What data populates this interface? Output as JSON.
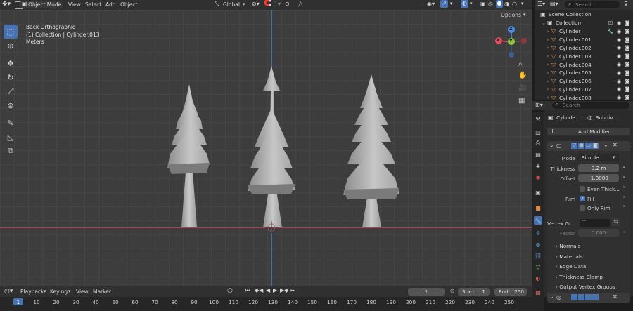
{
  "header": {
    "mode": "Object Mode",
    "menus": [
      "View",
      "Select",
      "Add",
      "Object"
    ],
    "orientation": "Global",
    "options_label": "Options"
  },
  "viewport": {
    "view_name": "Back Orthographic",
    "collection_line": "(1) Collection | Cylinder.013",
    "units": "Meters",
    "gizmo": {
      "z": "Z",
      "x": "X",
      "y": "Y"
    },
    "colors": {
      "x_axis": "#e24c5c",
      "y_axis": "#8dc540",
      "z_axis": "#4f8ee5",
      "background": "#3d3d3d"
    }
  },
  "outliner": {
    "search_placeholder": "Search",
    "scene_collection": "Scene Collection",
    "collection": "Collection",
    "items": [
      "Cylinder",
      "Cylinder.001",
      "Cylinder.002",
      "Cylinder.003",
      "Cylinder.004",
      "Cylinder.005",
      "Cylinder.006",
      "Cylinder.007",
      "Cylinder.008"
    ]
  },
  "properties": {
    "search_placeholder": "Search",
    "breadcrumb_object": "Cylinde...",
    "breadcrumb_modifier": "Subdiv...",
    "add_modifier": "Add Modifier",
    "mode_label": "Mode",
    "mode_value": "Simple",
    "thickness_label": "Thickness",
    "thickness_value": "0.2 m",
    "offset_label": "Offset",
    "offset_value": "-1.0000",
    "even_thickness": "Even Thick...",
    "rim_label": "Rim",
    "fill_label": "Fill",
    "only_rim": "Only Rim",
    "vertex_group_label": "Vertex Gr...",
    "factor_label": "Factor",
    "factor_value": "0.000",
    "sections": [
      "Normals",
      "Materials",
      "Edge Data",
      "Thickness Clamp",
      "Output Vertex Groups"
    ]
  },
  "timeline": {
    "menus": [
      "Playback",
      "Keying",
      "View",
      "Marker"
    ],
    "current_frame": "1",
    "start_label": "Start",
    "start_value": "1",
    "end_label": "End",
    "end_value": "250",
    "ticks": [
      "1",
      "10",
      "20",
      "30",
      "40",
      "50",
      "60",
      "70",
      "80",
      "90",
      "100",
      "110",
      "120",
      "130",
      "140",
      "150",
      "160",
      "170",
      "180",
      "190",
      "200",
      "210",
      "220",
      "230",
      "240",
      "250"
    ]
  }
}
